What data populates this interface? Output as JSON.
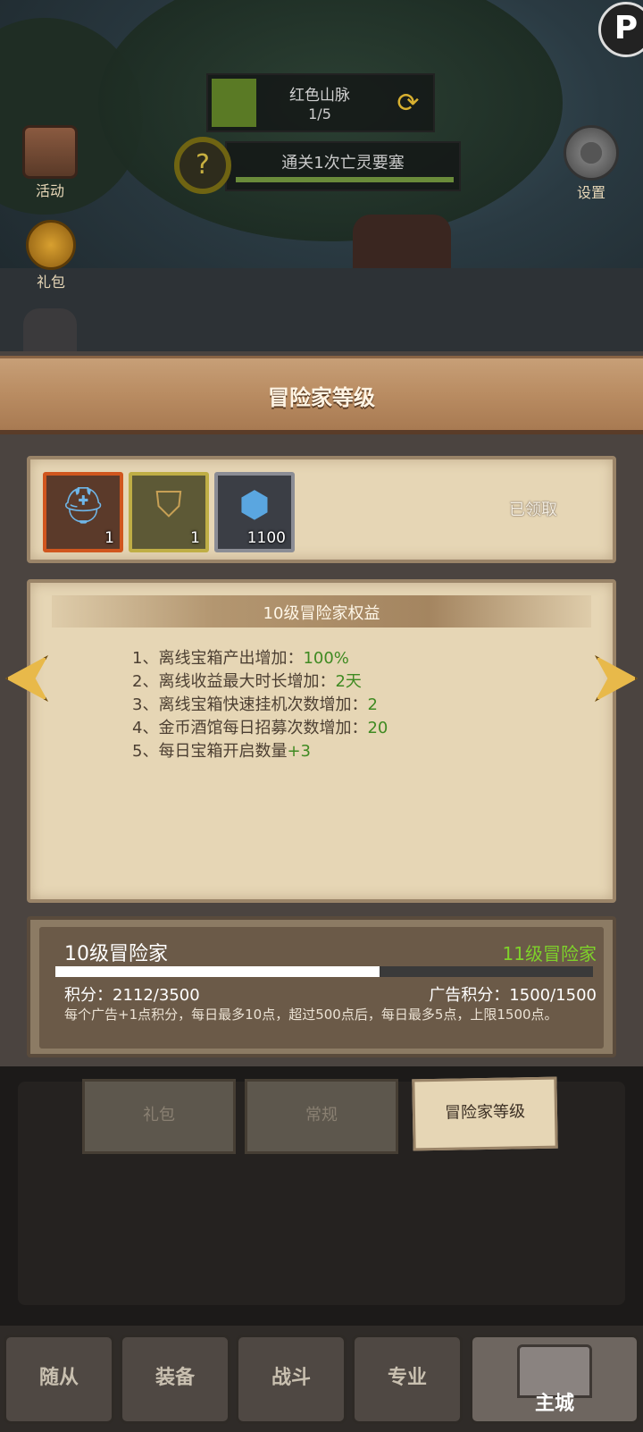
{
  "hud": {
    "region_name": "红色山脉",
    "region_progress": "1/5",
    "quest_text": "通关1次亡灵要塞",
    "quest_icon": "?",
    "activity_label": "活动",
    "gift_label": "礼包",
    "settings_label": "设置",
    "profile_letter": "P"
  },
  "panel": {
    "title": "冒险家等级",
    "rewards": [
      {
        "name": "helmet-chest",
        "qty": "1"
      },
      {
        "name": "armor-piece",
        "qty": "1"
      },
      {
        "name": "gem",
        "qty": "1100"
      }
    ],
    "claimed_label": "已领取",
    "benefits_title": "10级冒险家权益",
    "benefits": [
      {
        "text": "1、离线宝箱产出增加：",
        "value": "100%"
      },
      {
        "text": "2、离线收益最大时长增加：",
        "value": "2天"
      },
      {
        "text": "3、离线宝箱快速挂机次数增加：",
        "value": "2"
      },
      {
        "text": "4、金币酒馆每日招募次数增加：",
        "value": "20"
      },
      {
        "text": "5、每日宝箱开启数量",
        "value": "+3"
      }
    ],
    "level_current": "10级冒险家",
    "level_next": "11级冒险家",
    "xp_text": "积分：2112/3500",
    "xp_fraction": 0.6034,
    "ad_points_text": "广告积分：1500/1500",
    "note": "每个广告+1点积分，每日最多10点，超过500点后，每日最多5点，上限1500点。"
  },
  "tabs": {
    "gift": "礼包",
    "normal": "常规",
    "adventurer": "冒险家等级"
  },
  "nav": {
    "followers": "随从",
    "equipment": "装备",
    "battle": "战斗",
    "profession": "专业",
    "main_city": "主城"
  },
  "colors": {
    "accent_green": "#7ed22a",
    "value_green": "#3f8a22",
    "parchment": "#e6d6b5"
  }
}
